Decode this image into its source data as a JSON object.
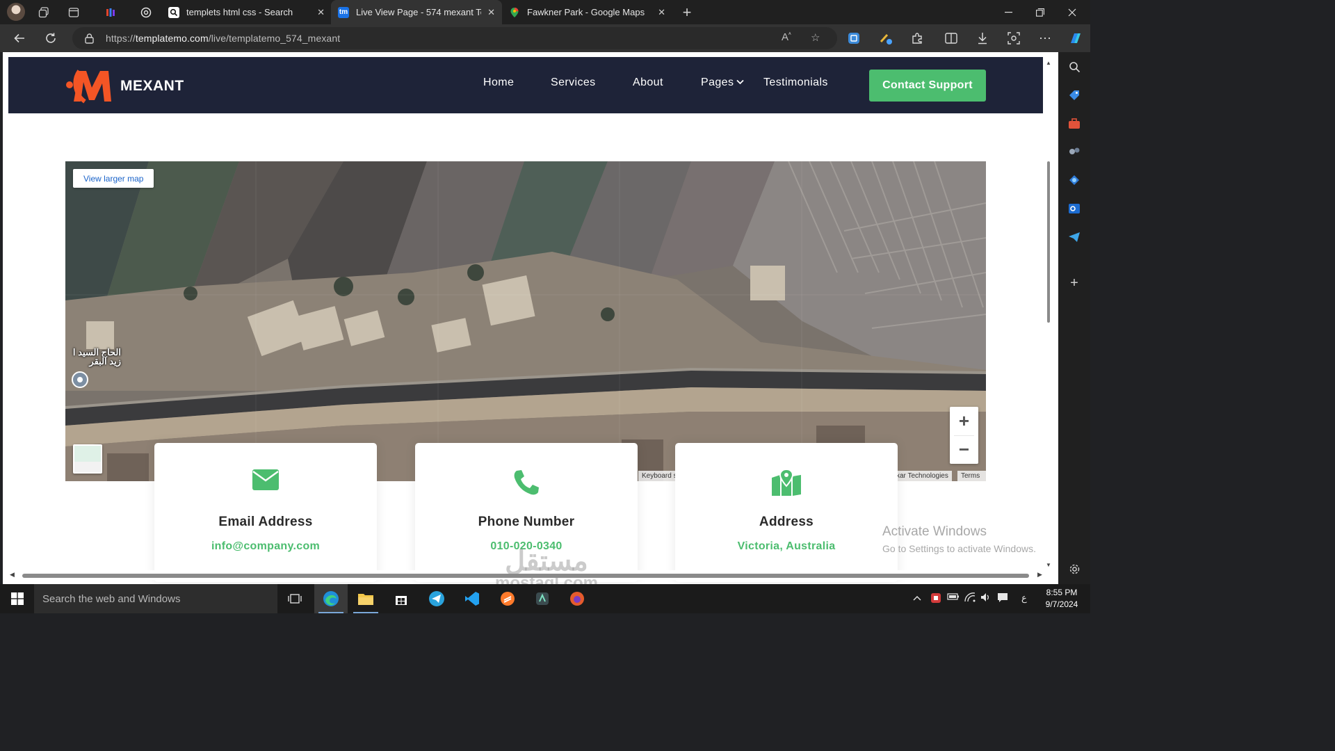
{
  "browser": {
    "tabs": [
      {
        "title": "templets html css - Search",
        "active": false
      },
      {
        "title": "Live View Page - 574 mexant Tem",
        "active": true,
        "favicon_text": "tm"
      },
      {
        "title": "Fawkner Park - Google Maps",
        "active": false
      }
    ],
    "url_prefix": "https://",
    "url_host": "templatemo.com",
    "url_path": "/live/templatemo_574_mexant"
  },
  "site": {
    "brand": "MEXANT",
    "nav": [
      {
        "label": "Home"
      },
      {
        "label": "Services"
      },
      {
        "label": "About"
      },
      {
        "label": "Pages"
      },
      {
        "label": "Testimonials"
      }
    ],
    "contact_button": "Contact Support",
    "accent_color": "#4cbd6f",
    "header_color": "#1e2338",
    "logo_color": "#f35525"
  },
  "map": {
    "view_larger": "View larger map",
    "place_label_line1": "الحاج السيد ا",
    "place_label_line2": "زيد البقر",
    "footer_keyboard": "Keyboard s",
    "footer_attrib": "xar Technologies",
    "footer_terms": "Terms"
  },
  "cards": [
    {
      "title": "Email Address",
      "value": "info@company.com",
      "icon": "envelope-icon"
    },
    {
      "title": "Phone Number",
      "value": "010-020-0340",
      "icon": "phone-icon"
    },
    {
      "title": "Address",
      "value": "Victoria, Australia",
      "icon": "map-marker-icon"
    }
  ],
  "windows": {
    "activate_title": "Activate Windows",
    "activate_sub": "Go to Settings to activate Windows.",
    "search_placeholder": "Search the web and Windows",
    "time": "8:55 PM",
    "date": "9/7/2024",
    "lang": "ع"
  },
  "watermark": {
    "line1": "مستقل",
    "line2": "mostaql.com"
  }
}
